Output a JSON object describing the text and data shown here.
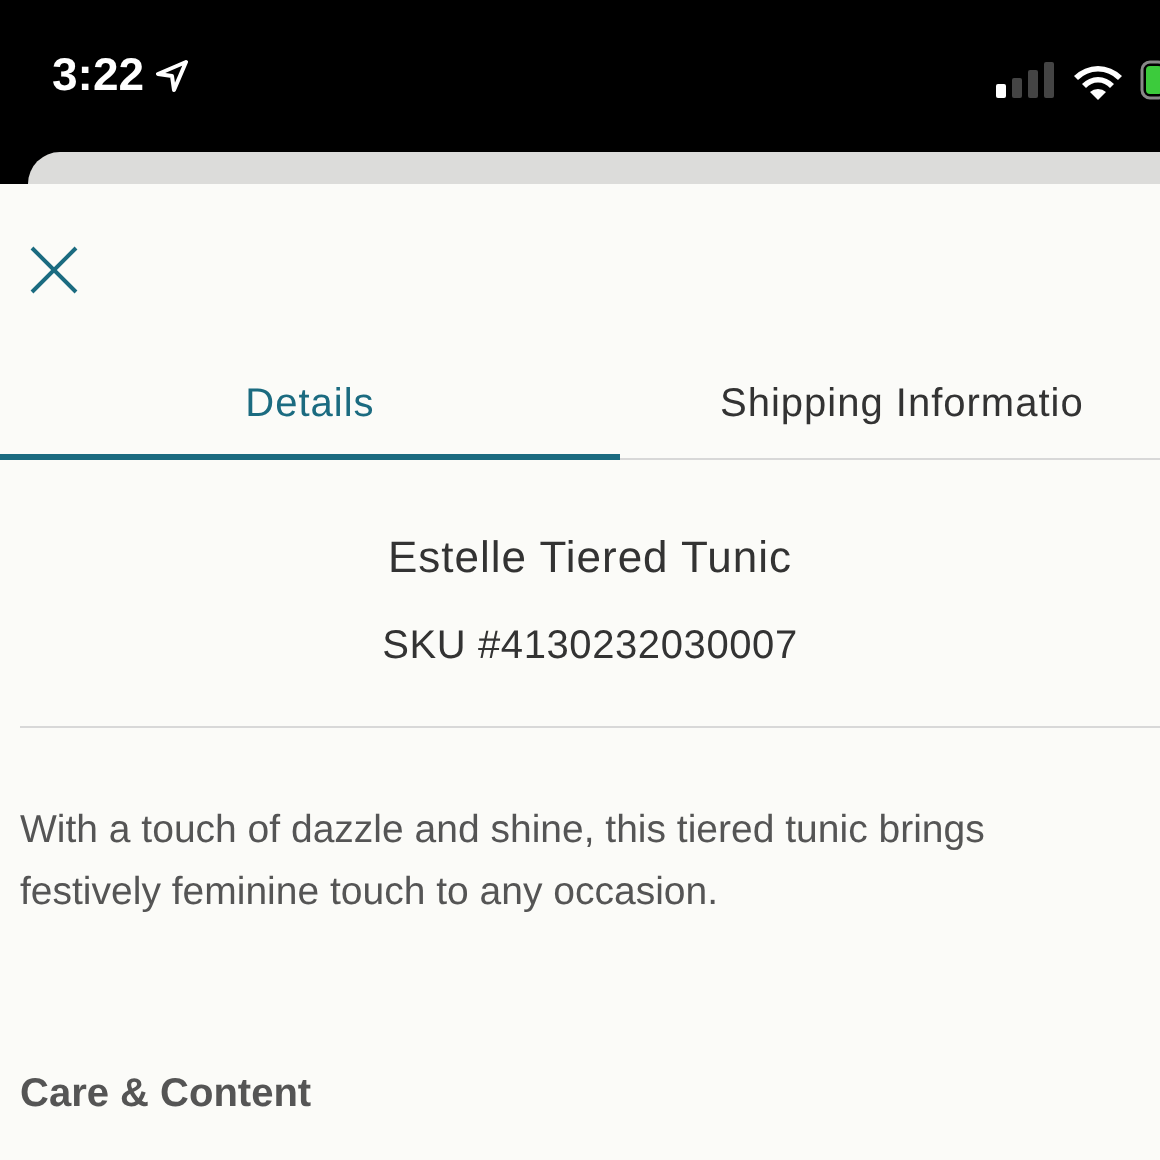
{
  "status_bar": {
    "time": "3:22"
  },
  "tabs": [
    {
      "label": "Details",
      "selected": true
    },
    {
      "label": "Shipping Informatio",
      "selected": false
    }
  ],
  "product": {
    "name": "Estelle Tiered Tunic",
    "sku": "SKU #4130232030007"
  },
  "description": {
    "lines": [
      "With a touch of dazzle and shine, this tiered tunic brings",
      "festively feminine touch to any occasion."
    ]
  },
  "section_heading": "Care & Content"
}
